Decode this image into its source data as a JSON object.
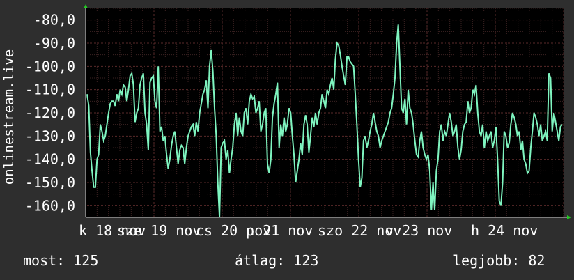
{
  "colors": {
    "background": "#2e2e2e",
    "plot_background": "#000000",
    "grid_major": "#5a2a2a",
    "grid_minor": "#3c2222",
    "line": "#7ff5c0",
    "axis_arrow": "#22cc22",
    "text": "#ffffff"
  },
  "footer": {
    "current": "most: 125",
    "average": "átlag: 123",
    "best": "legjobb: 82"
  },
  "chart_data": {
    "type": "line",
    "title": "",
    "xlabel": "",
    "ylabel": "onlinestream.live",
    "yticks": [
      "-80,0",
      "-90,0",
      "-100,0",
      "-110,0",
      "-120,0",
      "-130,0",
      "-140,0",
      "-150,0",
      "-160,0"
    ],
    "ytick_values": [
      -80,
      -90,
      -100,
      -110,
      -120,
      -130,
      -140,
      -150,
      -160
    ],
    "xticks": [
      "k 18 nov",
      "sze 19 nov",
      "cs 20 nov",
      "p 21 nov",
      "szo 22 nov",
      "v 23 nov",
      "h 24 nov"
    ],
    "xlim": [
      0,
      7
    ],
    "ylim": [
      -165,
      -75
    ],
    "grid": true,
    "series": [
      {
        "values": [
          -112,
          -117,
          -137,
          -145,
          -152,
          -152,
          -140,
          -138,
          -125,
          -128,
          -132,
          -130,
          -125,
          -120,
          -116,
          -115,
          -115,
          -117,
          -112,
          -115,
          -110,
          -112,
          -108,
          -109,
          -115,
          -110,
          -104,
          -103,
          -108,
          -124,
          -120,
          -118,
          -108,
          -105,
          -103,
          -120,
          -125,
          -136,
          -107,
          -105,
          -104,
          -115,
          -118,
          -100,
          -128,
          -126,
          -132,
          -130,
          -138,
          -144,
          -140,
          -134,
          -130,
          -128,
          -135,
          -142,
          -136,
          -134,
          -135,
          -142,
          -135,
          -130,
          -128,
          -126,
          -125,
          -130,
          -124,
          -128,
          -120,
          -116,
          -112,
          -110,
          -106,
          -118,
          -100,
          -93,
          -102,
          -118,
          -130,
          -150,
          -165,
          -135,
          -133,
          -132,
          -140,
          -136,
          -146,
          -140,
          -135,
          -125,
          -120,
          -130,
          -122,
          -128,
          -130,
          -120,
          -118,
          -125,
          -115,
          -112,
          -114,
          -113,
          -120,
          -118,
          -115,
          -128,
          -125,
          -120,
          -118,
          -142,
          -146,
          -140,
          -122,
          -116,
          -112,
          -107,
          -135,
          -125,
          -130,
          -122,
          -128,
          -125,
          -118,
          -120,
          -130,
          -138,
          -150,
          -145,
          -140,
          -133,
          -138,
          -125,
          -121,
          -125,
          -137,
          -130,
          -122,
          -126,
          -120,
          -125,
          -120,
          -118,
          -112,
          -115,
          -118,
          -110,
          -112,
          -108,
          -105,
          -110,
          -97,
          -90,
          -91,
          -95,
          -100,
          -104,
          -108,
          -96,
          -96,
          -98,
          -99,
          -100,
          -112,
          -125,
          -140,
          -152,
          -148,
          -132,
          -130,
          -135,
          -132,
          -128,
          -125,
          -120,
          -124,
          -128,
          -130,
          -135,
          -132,
          -130,
          -128,
          -126,
          -124,
          -120,
          -118,
          -112,
          -105,
          -90,
          -82,
          -100,
          -118,
          -120,
          -114,
          -125,
          -110,
          -118,
          -120,
          -125,
          -132,
          -138,
          -139,
          -132,
          -128,
          -135,
          -138,
          -140,
          -138,
          -145,
          -162,
          -150,
          -162,
          -145,
          -140,
          -128,
          -125,
          -132,
          -128,
          -130,
          -125,
          -120,
          -124,
          -130,
          -128,
          -125,
          -135,
          -140,
          -136,
          -128,
          -125,
          -124,
          -115,
          -120,
          -118,
          -110,
          -112,
          -108,
          -120,
          -128,
          -130,
          -125,
          -135,
          -128,
          -132,
          -130,
          -128,
          -135,
          -132,
          -126,
          -140,
          -158,
          -160,
          -150,
          -128,
          -130,
          -135,
          -133,
          -125,
          -120,
          -122,
          -125,
          -130,
          -128,
          -136,
          -132,
          -140,
          -142,
          -146,
          -145,
          -135,
          -128,
          -120,
          -122,
          -125,
          -130,
          -125,
          -132,
          -130,
          -128,
          -132,
          -103,
          -105,
          -128,
          -120,
          -124,
          -128,
          -132,
          -126,
          -125
        ]
      }
    ]
  }
}
